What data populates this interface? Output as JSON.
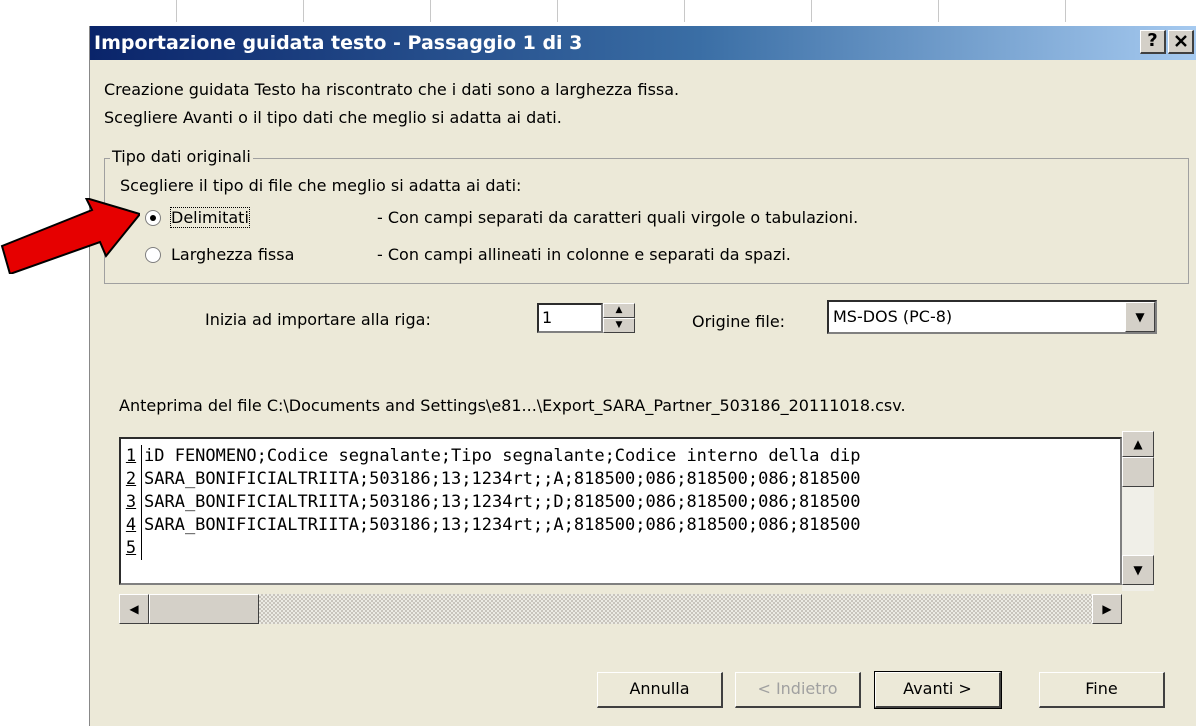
{
  "window": {
    "title": "Importazione guidata testo - Passaggio 1 di 3",
    "help_label": "?",
    "close_label": "✕"
  },
  "intro": {
    "line1": "Creazione guidata Testo ha riscontrato che i dati sono a larghezza fissa.",
    "line2": "Scegliere Avanti o il tipo dati che meglio si adatta ai dati."
  },
  "original_type": {
    "legend": "Tipo dati originali",
    "prompt": "Scegliere il tipo di file che meglio si adatta ai dati:",
    "options": [
      {
        "label": "Delimitati",
        "description": "- Con campi separati da caratteri quali virgole o tabulazioni.",
        "selected": true
      },
      {
        "label": "Larghezza fissa",
        "description": "- Con campi allineati in colonne e separati da spazi.",
        "selected": false
      }
    ]
  },
  "start_row": {
    "label": "Inizia ad importare alla riga:",
    "value": "1"
  },
  "file_origin": {
    "label": "Origine file:",
    "value": "MS-DOS (PC-8)"
  },
  "preview": {
    "label": "Anteprima del file C:\\Documents and Settings\\e81...\\Export_SARA_Partner_503186_20111018.csv.",
    "lines": [
      {
        "num": "1",
        "text": "iD FENOMENO;Codice segnalante;Tipo segnalante;Codice interno della dip"
      },
      {
        "num": "2",
        "text": "SARA_BONIFICIALTRIITA;503186;13;1234rt;;A;818500;086;818500;086;818500"
      },
      {
        "num": "3",
        "text": "SARA_BONIFICIALTRIITA;503186;13;1234rt;;D;818500;086;818500;086;818500"
      },
      {
        "num": "4",
        "text": "SARA_BONIFICIALTRIITA;503186;13;1234rt;;A;818500;086;818500;086;818500"
      },
      {
        "num": "5",
        "text": ""
      }
    ]
  },
  "buttons": {
    "cancel": "Annulla",
    "back": "< Indietro",
    "next": "Avanti >",
    "finish": "Fine"
  },
  "colors": {
    "annotation_arrow": "#e60000",
    "dialog_bg": "#ece9d8",
    "title_bar": "#0a246a"
  }
}
